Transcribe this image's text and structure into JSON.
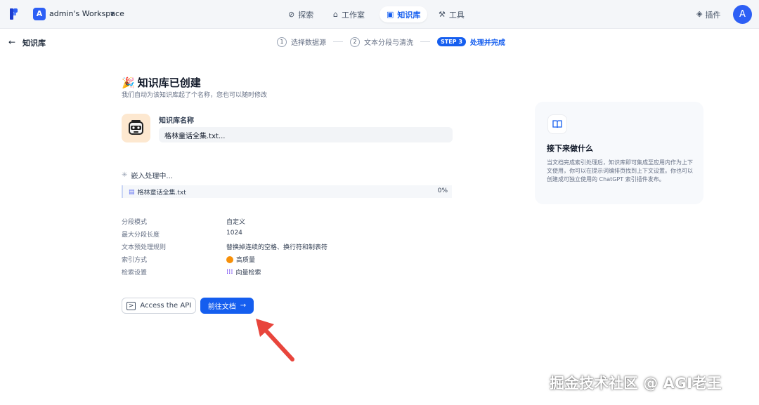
{
  "topbar": {
    "workspace_initial": "A",
    "workspace_name": "admin's Workspace",
    "nav": [
      {
        "label": "探索",
        "icon": "explore-icon"
      },
      {
        "label": "工作室",
        "icon": "studio-icon"
      },
      {
        "label": "知识库",
        "icon": "book-icon"
      },
      {
        "label": "工具",
        "icon": "tools-icon"
      }
    ],
    "plugins_label": "插件",
    "user_initial": "A"
  },
  "header": {
    "title": "知识库",
    "steps": [
      {
        "num": "1",
        "label": "选择数据源"
      },
      {
        "num": "2",
        "label": "文本分段与清洗"
      },
      {
        "badge": "STEP 3",
        "label": "处理并完成"
      }
    ]
  },
  "main": {
    "title": "知识库已创建",
    "title_emoji": "🎉",
    "subtitle": "我们自动为该知识库起了个名称，您也可以随时修改",
    "kb_name_label": "知识库名称",
    "kb_name_value": "格林童话全集.txt...",
    "embed_status": "嵌入处理中...",
    "file": {
      "name": "格林童话全集.txt",
      "progress": "0%"
    },
    "info": [
      {
        "label": "分段模式",
        "value": "自定义"
      },
      {
        "label": "最大分段长度",
        "value": "1024"
      },
      {
        "label": "文本预处理规则",
        "value": "替换掉连续的空格、换行符和制表符"
      },
      {
        "label": "索引方式",
        "value": "高质量",
        "icon": "high-quality-icon"
      },
      {
        "label": "检索设置",
        "value": "向量检索",
        "icon": "vector-search-icon"
      }
    ],
    "api_button": "Access the API",
    "go_button": "前往文档"
  },
  "side": {
    "title": "接下来做什么",
    "text": "当文档完成索引处理后，知识库即可集成至应用内作为上下文使用，你可以在提示词编排页找到上下文设置。你也可以创建成可独立使用的 ChatGPT 索引插件发布。"
  },
  "watermark": "掘金技术社区 @ AGI老王",
  "colors": {
    "accent": "#155eef",
    "annotation_arrow": "#e8453c"
  }
}
